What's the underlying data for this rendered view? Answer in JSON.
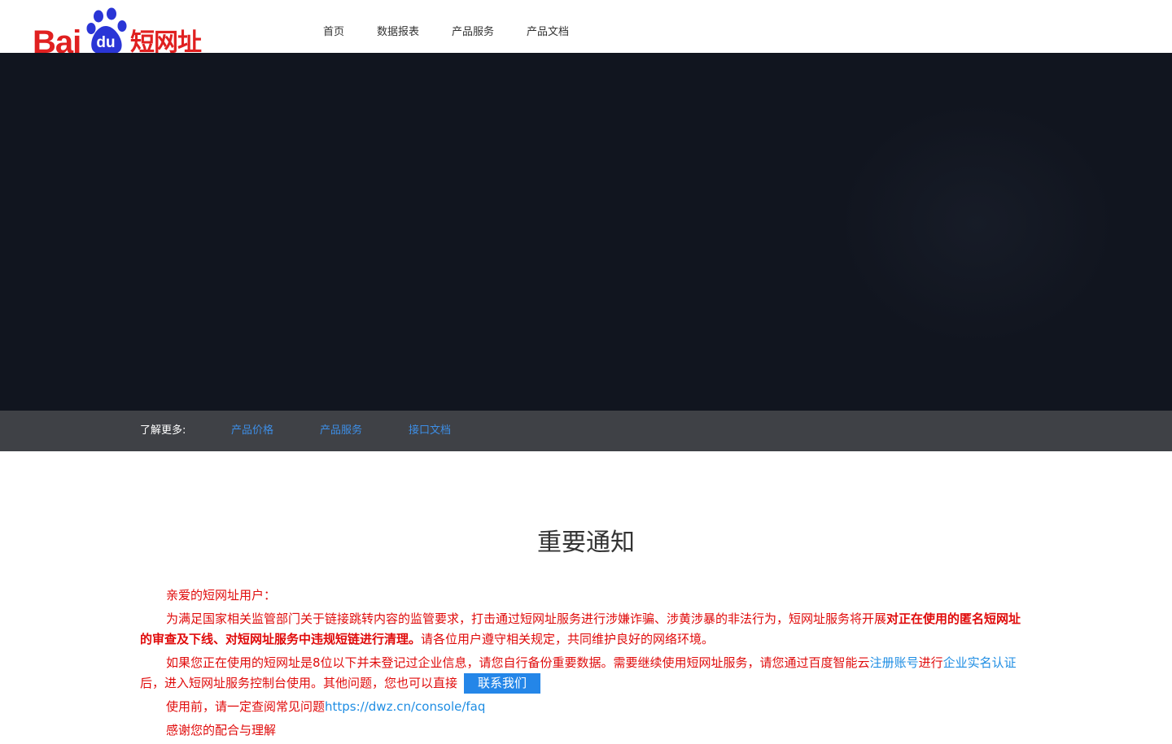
{
  "logo": {
    "text_latin": "Bai",
    "text_du": "du",
    "text_cn": "短网址"
  },
  "nav": {
    "items": [
      {
        "label": "首页"
      },
      {
        "label": "数据报表"
      },
      {
        "label": "产品服务"
      },
      {
        "label": "产品文档"
      }
    ]
  },
  "hero": {
    "background": "#11151f"
  },
  "more_bar": {
    "title": "了解更多:",
    "links": [
      {
        "label": "产品价格"
      },
      {
        "label": "产品服务"
      },
      {
        "label": "接口文档"
      }
    ]
  },
  "notice": {
    "title": "重要通知",
    "greeting": "亲爱的短网址用户：",
    "para1_text": "为满足国家相关监管部门关于链接跳转内容的监管要求，打击通过短网址服务进行涉嫌诈骗、涉黄涉暴的非法行为，短网址服务将开展",
    "para1_bold": "对正在使用的匿名短网址的审查及下线、对短网址服务中违规短链进行清理。",
    "para1_tail": "请各位用户遵守相关规定，共同维护良好的网络环境。",
    "para2_a": "如果您正在使用的短网址是8位以下并未登记过企业信息，请您自行备份重要数据。需要继续使用短网址服务，请您通过百度智能云",
    "para2_link1": "注册账号",
    "para2_b": "进行",
    "para2_link2": "企业实名认证",
    "para2_c": "后，进入短网址服务控制台使用。其他问题，您也可以直接",
    "contact_button": "联系我们",
    "para3_text": "使用前，请一定查阅常见问题",
    "para3_link": "https://dwz.cn/console/faq",
    "para4_text": "感谢您的配合与理解"
  },
  "colors": {
    "brand_red": "#e02020",
    "paw_blue": "#2a35d6",
    "link_blue": "#1e8de3",
    "notice_red": "#e00b0b",
    "button_blue": "#2486e8",
    "bar_gray": "#3f4146"
  }
}
